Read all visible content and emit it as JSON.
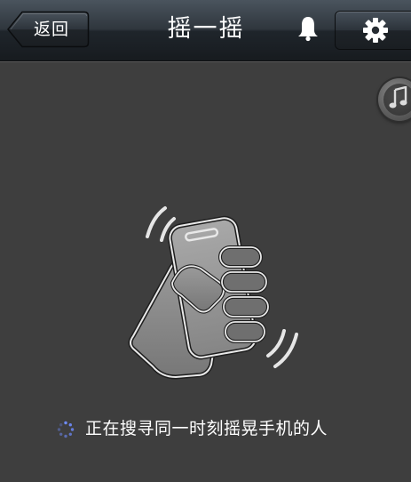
{
  "navbar": {
    "back_label": "返回",
    "title": "摇一摇",
    "bell_icon": "bell-icon",
    "settings_icon": "gear-icon"
  },
  "music_toggle": {
    "icon": "music-note-icon"
  },
  "illustration": {
    "icon": "shaking-hand-phone-icon"
  },
  "status": {
    "icon": "loading-spinner-icon",
    "text": "正在搜寻同一时刻摇晃手机的人"
  },
  "colors": {
    "background": "#3e3e3e",
    "navbar_top": "#4a545e",
    "navbar_bottom": "#171b1f",
    "text": "#ffffff",
    "spinner": "#6f8cff"
  }
}
